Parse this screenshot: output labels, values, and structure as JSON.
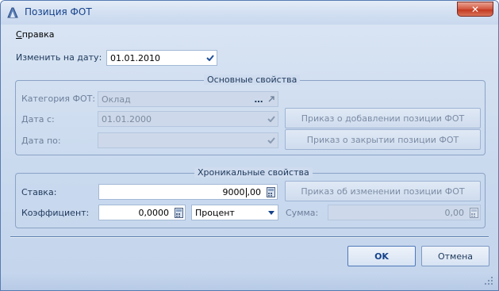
{
  "window": {
    "title": "Позиция ФОТ",
    "close_label": "✕"
  },
  "menu": {
    "help": "Справка"
  },
  "change_date": {
    "label": "Изменить на дату:",
    "value": "01.01.2010"
  },
  "main_group": {
    "title": "Основные свойства",
    "category": {
      "label": "Категория ФОТ:",
      "value": "Оклад"
    },
    "date_from": {
      "label": "Дата с:",
      "value": "01.01.2000"
    },
    "date_to": {
      "label": "Дата по:",
      "value": ""
    },
    "btn_add": "Приказ о добавлении позиции ФОТ",
    "btn_close": "Приказ о закрытии позиции ФОТ"
  },
  "chron_group": {
    "title": "Хроникальные свойства",
    "rate": {
      "label": "Ставка:",
      "value_int": "9000",
      "value_dec": ",00"
    },
    "btn_change": "Приказ об изменении позиции ФОТ",
    "coef": {
      "label": "Коэффициент:",
      "value": "0,0000"
    },
    "coef_type": {
      "value": "Процент"
    },
    "sum": {
      "label": "Сумма:",
      "value": "0,00"
    }
  },
  "footer": {
    "ok_label": "OK",
    "cancel_label": "Отмена"
  }
}
